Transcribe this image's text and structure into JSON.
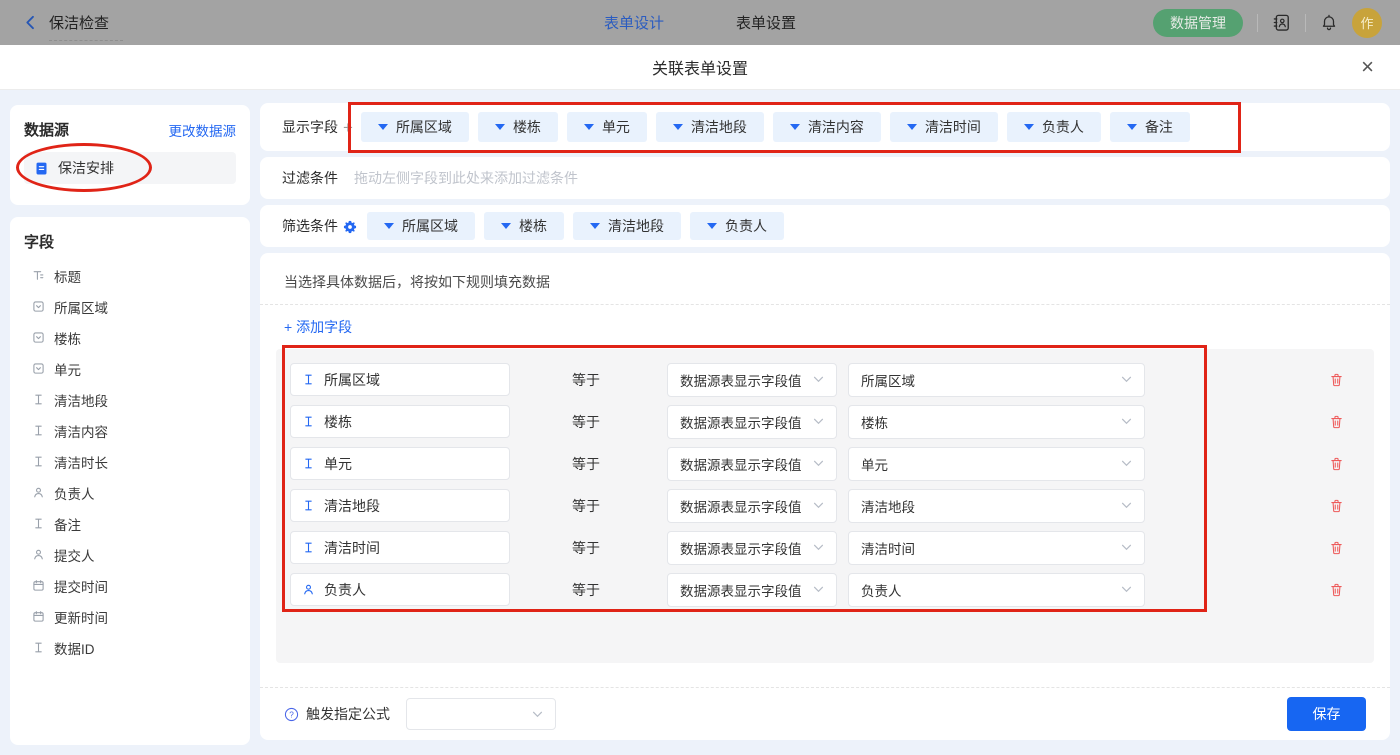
{
  "topbar": {
    "back_label": "保洁检查",
    "tabs": [
      {
        "label": "表单设计",
        "active": true
      },
      {
        "label": "表单设置",
        "active": false
      }
    ],
    "data_manage_button": "数据管理",
    "avatar_text": "作"
  },
  "modal": {
    "title": "关联表单设置",
    "close_icon": "×"
  },
  "datasource_panel": {
    "title": "数据源",
    "change_link": "更改数据源",
    "source": {
      "icon": "document-icon",
      "label": "保洁安排"
    }
  },
  "fields_panel": {
    "title": "字段",
    "items": [
      {
        "icon": "title-field-icon",
        "label": "标题"
      },
      {
        "icon": "select-field-icon",
        "label": "所属区域"
      },
      {
        "icon": "select-field-icon",
        "label": "楼栋"
      },
      {
        "icon": "select-field-icon",
        "label": "单元"
      },
      {
        "icon": "text-field-icon",
        "label": "清洁地段"
      },
      {
        "icon": "text-field-icon",
        "label": "清洁内容"
      },
      {
        "icon": "text-field-icon",
        "label": "清洁时长"
      },
      {
        "icon": "person-field-icon",
        "label": "负责人"
      },
      {
        "icon": "text-field-icon",
        "label": "备注"
      },
      {
        "icon": "person-field-icon",
        "label": "提交人"
      },
      {
        "icon": "date-field-icon",
        "label": "提交时间"
      },
      {
        "icon": "date-field-icon",
        "label": "更新时间"
      },
      {
        "icon": "text-field-icon",
        "label": "数据ID"
      }
    ]
  },
  "display_row": {
    "label": "显示字段",
    "add_button": "+",
    "tags": [
      "所属区域",
      "楼栋",
      "单元",
      "清洁地段",
      "清洁内容",
      "清洁时间",
      "负责人",
      "备注"
    ]
  },
  "filter_row": {
    "label": "过滤条件",
    "placeholder": "拖动左侧字段到此处来添加过滤条件"
  },
  "screen_row": {
    "label": "筛选条件",
    "gear_icon": "gear-icon",
    "tags": [
      "所属区域",
      "楼栋",
      "清洁地段",
      "负责人"
    ]
  },
  "rules_panel": {
    "intro": "当选择具体数据后，将按如下规则填充数据",
    "add_field_link": "+ 添加字段",
    "rows": [
      {
        "icon": "text-field-icon",
        "field": "所属区域",
        "operator": "等于",
        "source": "数据源表显示字段值",
        "target": "所属区域"
      },
      {
        "icon": "text-field-icon",
        "field": "楼栋",
        "operator": "等于",
        "source": "数据源表显示字段值",
        "target": "楼栋"
      },
      {
        "icon": "text-field-icon",
        "field": "单元",
        "operator": "等于",
        "source": "数据源表显示字段值",
        "target": "单元"
      },
      {
        "icon": "text-field-icon",
        "field": "清洁地段",
        "operator": "等于",
        "source": "数据源表显示字段值",
        "target": "清洁地段"
      },
      {
        "icon": "text-field-icon",
        "field": "清洁时间",
        "operator": "等于",
        "source": "数据源表显示字段值",
        "target": "清洁时间"
      },
      {
        "icon": "person-field-icon",
        "field": "负责人",
        "operator": "等于",
        "source": "数据源表显示字段值",
        "target": "负责人"
      }
    ]
  },
  "footer": {
    "help_icon": "question-circle-icon",
    "formula_label": "触发指定公式",
    "formula_value": "",
    "save_button": "保存"
  },
  "colors": {
    "accent_blue": "#2468f2",
    "annotation_red": "#e02417",
    "tag_bg": "#e9f2fd",
    "save_blue": "#1766f2",
    "trash_red": "#ee5a5a",
    "avatar_gold": "#c8a33b",
    "data_manage_green": "#55a171"
  }
}
